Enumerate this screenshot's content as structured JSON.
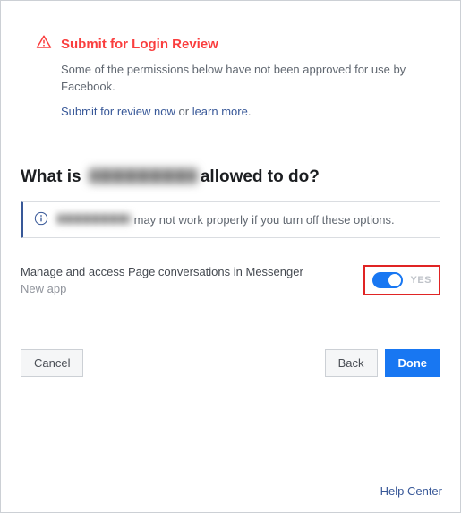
{
  "alert": {
    "title": "Submit for Login Review",
    "body": "Some of the permissions below have not been approved for use by Facebook.",
    "submit_link": "Submit for review now",
    "or": " or ",
    "learn_link": "learn more",
    "period": "."
  },
  "section": {
    "prefix": "What is ",
    "suffix": "allowed to do?"
  },
  "info": {
    "text": "may not work properly if you turn off these options."
  },
  "permission": {
    "label": "Manage and access Page conversations in Messenger",
    "sub": "New app",
    "state": "YES"
  },
  "buttons": {
    "cancel": "Cancel",
    "back": "Back",
    "done": "Done"
  },
  "footer": {
    "help": "Help Center"
  }
}
